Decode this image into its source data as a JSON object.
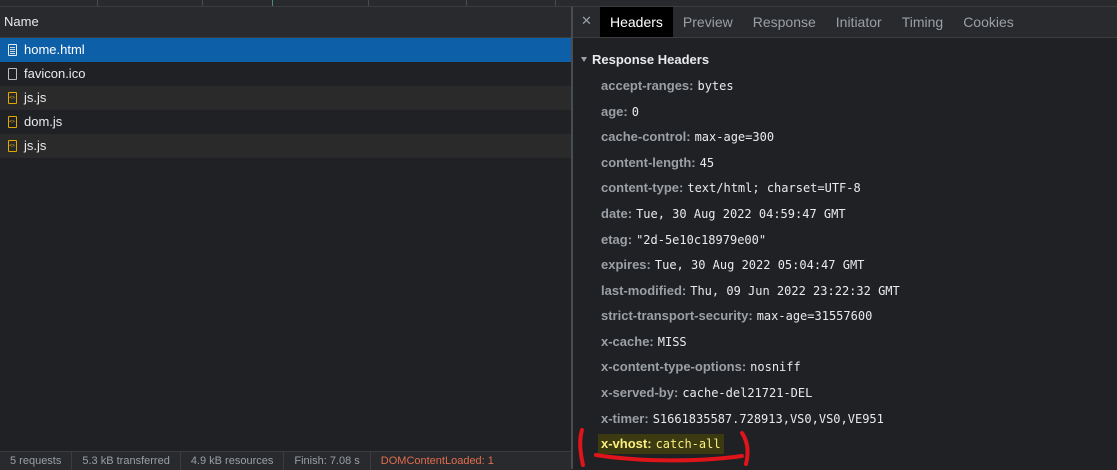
{
  "network": {
    "column_name": "Name",
    "rows": [
      {
        "name": "home.html",
        "icon": "document-icon",
        "selected": true
      },
      {
        "name": "favicon.ico",
        "icon": "file-icon"
      },
      {
        "name": "js.js",
        "icon": "script-icon"
      },
      {
        "name": "dom.js",
        "icon": "script-icon"
      },
      {
        "name": "js.js",
        "icon": "script-icon"
      }
    ],
    "status": {
      "requests": "5 requests",
      "transferred": "5.3 kB transferred",
      "resources": "4.9 kB resources",
      "finish": "Finish: 7.08 s",
      "domcontentloaded": "DOMContentLoaded: 1"
    }
  },
  "details": {
    "tabs": [
      "Headers",
      "Preview",
      "Response",
      "Initiator",
      "Timing",
      "Cookies"
    ],
    "active_tab": "Headers",
    "section_title": "Response Headers",
    "headers": [
      {
        "key": "accept-ranges:",
        "value": "bytes"
      },
      {
        "key": "age:",
        "value": "0"
      },
      {
        "key": "cache-control:",
        "value": "max-age=300"
      },
      {
        "key": "content-length:",
        "value": "45"
      },
      {
        "key": "content-type:",
        "value": "text/html; charset=UTF-8"
      },
      {
        "key": "date:",
        "value": "Tue, 30 Aug 2022 04:59:47 GMT"
      },
      {
        "key": "etag:",
        "value": "\"2d-5e10c18979e00\""
      },
      {
        "key": "expires:",
        "value": "Tue, 30 Aug 2022 05:04:47 GMT"
      },
      {
        "key": "last-modified:",
        "value": "Thu, 09 Jun 2022 23:22:32 GMT"
      },
      {
        "key": "strict-transport-security:",
        "value": "max-age=31557600"
      },
      {
        "key": "x-cache:",
        "value": "MISS"
      },
      {
        "key": "x-content-type-options:",
        "value": "nosniff"
      },
      {
        "key": "x-served-by:",
        "value": "cache-del21721-DEL"
      },
      {
        "key": "x-timer:",
        "value": "S1661835587.728913,VS0,VS0,VE951"
      },
      {
        "key": "x-vhost:",
        "value": "catch-all",
        "highlighted": true
      }
    ]
  },
  "colors": {
    "selected_row": "#0d60a8",
    "highlight_text": "#fbee7f",
    "annotation": "#e0141b"
  }
}
